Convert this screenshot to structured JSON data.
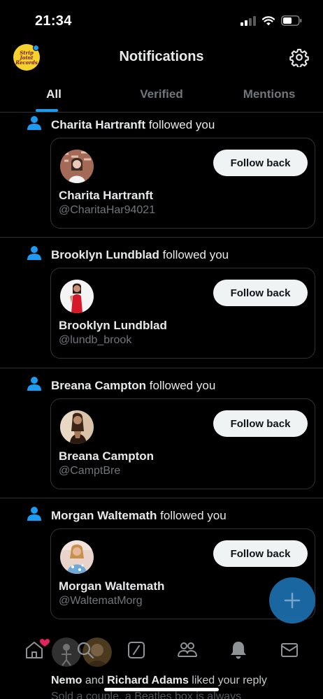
{
  "status_bar": {
    "time": "21:34"
  },
  "header": {
    "title": "Notifications",
    "logo_lines": [
      "Strip",
      "Joint",
      "Records"
    ]
  },
  "tabs": [
    {
      "label": "All",
      "active": true
    },
    {
      "label": "Verified",
      "active": false
    },
    {
      "label": "Mentions",
      "active": false
    }
  ],
  "notifications": [
    {
      "name": "Charita Hartranft",
      "action": "followed you",
      "card_name": "Charita Hartranft",
      "handle": "@CharitaHar94021",
      "button": "Follow back"
    },
    {
      "name": "Brooklyn Lundblad",
      "action": "followed you",
      "card_name": "Brooklyn Lundblad",
      "handle": "@lundb_brook",
      "button": "Follow back"
    },
    {
      "name": "Breana Campton",
      "action": "followed you",
      "card_name": "Breana Campton",
      "handle": "@CamptBre",
      "button": "Follow back"
    },
    {
      "name": "Morgan Waltemath",
      "action": "followed you",
      "card_name": "Morgan Waltemath",
      "handle": "@WaltematMorg",
      "button": "Follow back"
    }
  ],
  "next_notification": {
    "name1": "Nemo",
    "joiner": "and",
    "name2": "Richard Adams",
    "action": "liked your reply",
    "snippet": "Sold a couple, a Beatles box is always"
  },
  "bottom_nav": [
    "home-icon",
    "search-icon",
    "grok-icon",
    "communities-icon",
    "bell-icon",
    "mail-icon"
  ],
  "colors": {
    "accent": "#1d9bf0",
    "background": "#000000",
    "button_bg": "#eff3f4",
    "secondary_text": "#71767b",
    "divider": "#2f3336"
  }
}
